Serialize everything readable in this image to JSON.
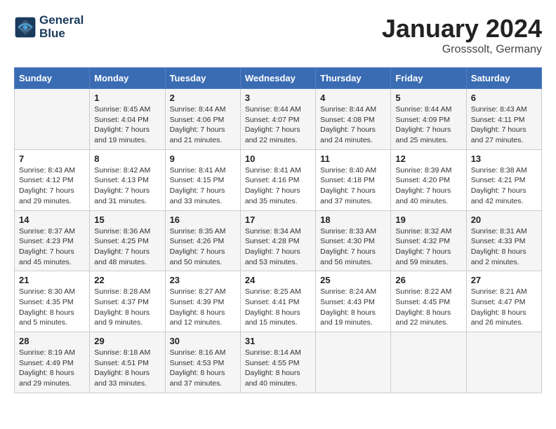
{
  "header": {
    "logo_line1": "General",
    "logo_line2": "Blue",
    "month_title": "January 2024",
    "location": "Grosssolt, Germany"
  },
  "days_of_week": [
    "Sunday",
    "Monday",
    "Tuesday",
    "Wednesday",
    "Thursday",
    "Friday",
    "Saturday"
  ],
  "weeks": [
    [
      {
        "day": "",
        "sunrise": "",
        "sunset": "",
        "daylight": ""
      },
      {
        "day": "1",
        "sunrise": "Sunrise: 8:45 AM",
        "sunset": "Sunset: 4:04 PM",
        "daylight": "Daylight: 7 hours and 19 minutes."
      },
      {
        "day": "2",
        "sunrise": "Sunrise: 8:44 AM",
        "sunset": "Sunset: 4:06 PM",
        "daylight": "Daylight: 7 hours and 21 minutes."
      },
      {
        "day": "3",
        "sunrise": "Sunrise: 8:44 AM",
        "sunset": "Sunset: 4:07 PM",
        "daylight": "Daylight: 7 hours and 22 minutes."
      },
      {
        "day": "4",
        "sunrise": "Sunrise: 8:44 AM",
        "sunset": "Sunset: 4:08 PM",
        "daylight": "Daylight: 7 hours and 24 minutes."
      },
      {
        "day": "5",
        "sunrise": "Sunrise: 8:44 AM",
        "sunset": "Sunset: 4:09 PM",
        "daylight": "Daylight: 7 hours and 25 minutes."
      },
      {
        "day": "6",
        "sunrise": "Sunrise: 8:43 AM",
        "sunset": "Sunset: 4:11 PM",
        "daylight": "Daylight: 7 hours and 27 minutes."
      }
    ],
    [
      {
        "day": "7",
        "sunrise": "Sunrise: 8:43 AM",
        "sunset": "Sunset: 4:12 PM",
        "daylight": "Daylight: 7 hours and 29 minutes."
      },
      {
        "day": "8",
        "sunrise": "Sunrise: 8:42 AM",
        "sunset": "Sunset: 4:13 PM",
        "daylight": "Daylight: 7 hours and 31 minutes."
      },
      {
        "day": "9",
        "sunrise": "Sunrise: 8:41 AM",
        "sunset": "Sunset: 4:15 PM",
        "daylight": "Daylight: 7 hours and 33 minutes."
      },
      {
        "day": "10",
        "sunrise": "Sunrise: 8:41 AM",
        "sunset": "Sunset: 4:16 PM",
        "daylight": "Daylight: 7 hours and 35 minutes."
      },
      {
        "day": "11",
        "sunrise": "Sunrise: 8:40 AM",
        "sunset": "Sunset: 4:18 PM",
        "daylight": "Daylight: 7 hours and 37 minutes."
      },
      {
        "day": "12",
        "sunrise": "Sunrise: 8:39 AM",
        "sunset": "Sunset: 4:20 PM",
        "daylight": "Daylight: 7 hours and 40 minutes."
      },
      {
        "day": "13",
        "sunrise": "Sunrise: 8:38 AM",
        "sunset": "Sunset: 4:21 PM",
        "daylight": "Daylight: 7 hours and 42 minutes."
      }
    ],
    [
      {
        "day": "14",
        "sunrise": "Sunrise: 8:37 AM",
        "sunset": "Sunset: 4:23 PM",
        "daylight": "Daylight: 7 hours and 45 minutes."
      },
      {
        "day": "15",
        "sunrise": "Sunrise: 8:36 AM",
        "sunset": "Sunset: 4:25 PM",
        "daylight": "Daylight: 7 hours and 48 minutes."
      },
      {
        "day": "16",
        "sunrise": "Sunrise: 8:35 AM",
        "sunset": "Sunset: 4:26 PM",
        "daylight": "Daylight: 7 hours and 50 minutes."
      },
      {
        "day": "17",
        "sunrise": "Sunrise: 8:34 AM",
        "sunset": "Sunset: 4:28 PM",
        "daylight": "Daylight: 7 hours and 53 minutes."
      },
      {
        "day": "18",
        "sunrise": "Sunrise: 8:33 AM",
        "sunset": "Sunset: 4:30 PM",
        "daylight": "Daylight: 7 hours and 56 minutes."
      },
      {
        "day": "19",
        "sunrise": "Sunrise: 8:32 AM",
        "sunset": "Sunset: 4:32 PM",
        "daylight": "Daylight: 7 hours and 59 minutes."
      },
      {
        "day": "20",
        "sunrise": "Sunrise: 8:31 AM",
        "sunset": "Sunset: 4:33 PM",
        "daylight": "Daylight: 8 hours and 2 minutes."
      }
    ],
    [
      {
        "day": "21",
        "sunrise": "Sunrise: 8:30 AM",
        "sunset": "Sunset: 4:35 PM",
        "daylight": "Daylight: 8 hours and 5 minutes."
      },
      {
        "day": "22",
        "sunrise": "Sunrise: 8:28 AM",
        "sunset": "Sunset: 4:37 PM",
        "daylight": "Daylight: 8 hours and 9 minutes."
      },
      {
        "day": "23",
        "sunrise": "Sunrise: 8:27 AM",
        "sunset": "Sunset: 4:39 PM",
        "daylight": "Daylight: 8 hours and 12 minutes."
      },
      {
        "day": "24",
        "sunrise": "Sunrise: 8:25 AM",
        "sunset": "Sunset: 4:41 PM",
        "daylight": "Daylight: 8 hours and 15 minutes."
      },
      {
        "day": "25",
        "sunrise": "Sunrise: 8:24 AM",
        "sunset": "Sunset: 4:43 PM",
        "daylight": "Daylight: 8 hours and 19 minutes."
      },
      {
        "day": "26",
        "sunrise": "Sunrise: 8:22 AM",
        "sunset": "Sunset: 4:45 PM",
        "daylight": "Daylight: 8 hours and 22 minutes."
      },
      {
        "day": "27",
        "sunrise": "Sunrise: 8:21 AM",
        "sunset": "Sunset: 4:47 PM",
        "daylight": "Daylight: 8 hours and 26 minutes."
      }
    ],
    [
      {
        "day": "28",
        "sunrise": "Sunrise: 8:19 AM",
        "sunset": "Sunset: 4:49 PM",
        "daylight": "Daylight: 8 hours and 29 minutes."
      },
      {
        "day": "29",
        "sunrise": "Sunrise: 8:18 AM",
        "sunset": "Sunset: 4:51 PM",
        "daylight": "Daylight: 8 hours and 33 minutes."
      },
      {
        "day": "30",
        "sunrise": "Sunrise: 8:16 AM",
        "sunset": "Sunset: 4:53 PM",
        "daylight": "Daylight: 8 hours and 37 minutes."
      },
      {
        "day": "31",
        "sunrise": "Sunrise: 8:14 AM",
        "sunset": "Sunset: 4:55 PM",
        "daylight": "Daylight: 8 hours and 40 minutes."
      },
      {
        "day": "",
        "sunrise": "",
        "sunset": "",
        "daylight": ""
      },
      {
        "day": "",
        "sunrise": "",
        "sunset": "",
        "daylight": ""
      },
      {
        "day": "",
        "sunrise": "",
        "sunset": "",
        "daylight": ""
      }
    ]
  ]
}
